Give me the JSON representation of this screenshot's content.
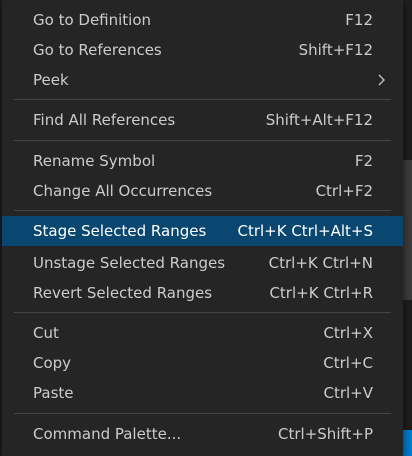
{
  "menu": {
    "items": [
      {
        "label": "Go to Definition",
        "shortcut": "F12"
      },
      {
        "label": "Go to References",
        "shortcut": "Shift+F12"
      },
      {
        "label": "Peek",
        "submenu_icon": "chevron-right-icon"
      },
      {
        "label": "Find All References",
        "shortcut": "Shift+Alt+F12"
      },
      {
        "label": "Rename Symbol",
        "shortcut": "F2"
      },
      {
        "label": "Change All Occurrences",
        "shortcut": "Ctrl+F2"
      },
      {
        "label": "Stage Selected Ranges",
        "shortcut": "Ctrl+K Ctrl+Alt+S",
        "selected": true
      },
      {
        "label": "Unstage Selected Ranges",
        "shortcut": "Ctrl+K Ctrl+N"
      },
      {
        "label": "Revert Selected Ranges",
        "shortcut": "Ctrl+K Ctrl+R"
      },
      {
        "label": "Cut",
        "shortcut": "Ctrl+X"
      },
      {
        "label": "Copy",
        "shortcut": "Ctrl+C"
      },
      {
        "label": "Paste",
        "shortcut": "Ctrl+V"
      },
      {
        "label": "Command Palette...",
        "shortcut": "Ctrl+Shift+P"
      }
    ]
  },
  "colors": {
    "menu_background": "#252526",
    "selection": "#094771",
    "text": "#cccccc",
    "separator": "#454545"
  }
}
